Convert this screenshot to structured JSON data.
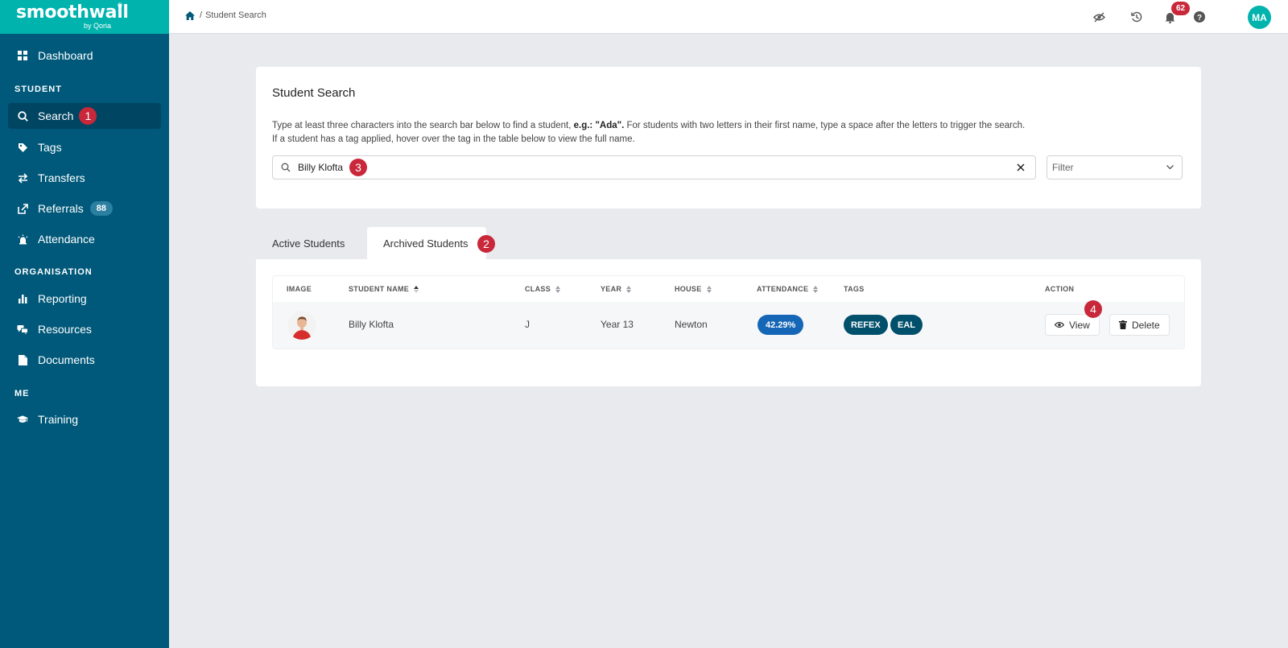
{
  "brand": {
    "name": "smoothwall",
    "sub": "by Qoria",
    "color": "#00b3ad"
  },
  "sidebar": {
    "dashboard": "Dashboard",
    "section_student": "STUDENT",
    "search": "Search",
    "search_marker": "1",
    "tags": "Tags",
    "transfers": "Transfers",
    "referrals": "Referrals",
    "referrals_count": "88",
    "attendance": "Attendance",
    "section_org": "ORGANISATION",
    "reporting": "Reporting",
    "resources": "Resources",
    "documents": "Documents",
    "section_me": "ME",
    "training": "Training"
  },
  "topbar": {
    "breadcrumb_sep": "/",
    "breadcrumb_current": "Student Search",
    "notifications_count": "62",
    "avatar_initials": "MA"
  },
  "search_card": {
    "title": "Student Search",
    "help_part1": "Type at least three characters into the search bar below to find a student, ",
    "help_example_label": "e.g.: \"Ada\".",
    "help_part2": " For students with two letters in their first name, type a space after the letters to trigger the search.",
    "help_line2": "If a student has a tag applied, hover over the tag in the table below to view the full name.",
    "search_value": "Billy Klofta",
    "search_marker": "3",
    "filter_placeholder": "Filter"
  },
  "tabs": {
    "active": "Active Students",
    "archived": "Archived Students",
    "archived_marker": "2"
  },
  "table": {
    "headers": {
      "image": "IMAGE",
      "name": "STUDENT NAME",
      "class": "CLASS",
      "year": "YEAR",
      "house": "HOUSE",
      "attendance": "ATTENDANCE",
      "tags": "TAGS",
      "action": "ACTION"
    },
    "rows": [
      {
        "name": "Billy Klofta",
        "class": "J",
        "year": "Year 13",
        "house": "Newton",
        "attendance": "42.29%",
        "tags": [
          "REFEX",
          "EAL"
        ],
        "view": "View",
        "delete": "Delete",
        "view_marker": "4"
      }
    ]
  }
}
